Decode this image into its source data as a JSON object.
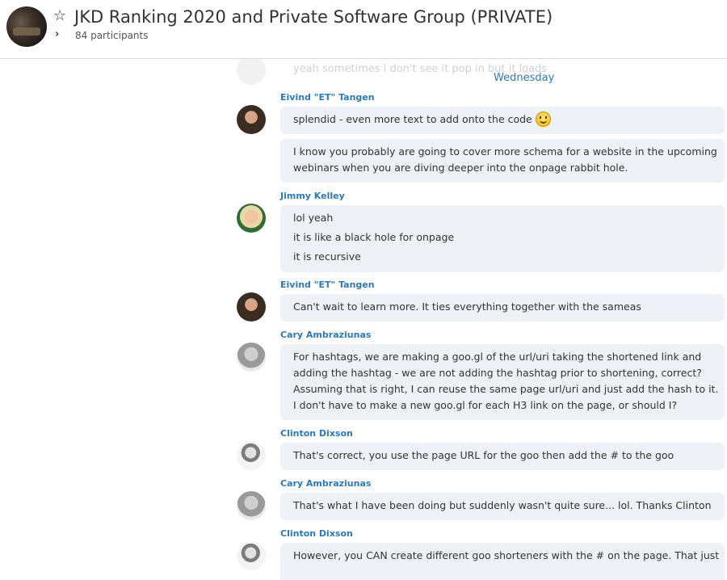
{
  "header": {
    "title": "JKD Ranking 2020 and Private Software Group (PRIVATE)",
    "participants": "84 participants",
    "star_icon": "star-icon",
    "chevron_icon": "chevron-right-icon"
  },
  "chat": {
    "ghost_text": "yeah sometimes i don't see it pop in but it loads",
    "date_divider": "Wednesday",
    "groups": [
      {
        "sender": "Eivind \"ET\" Tangen",
        "messages": [
          "splendid - even more text to add onto the code",
          [
            "I know you probably are going to cover more schema for a website in the upcoming",
            "webinars when you are diving deeper into the onpage rabbit hole."
          ]
        ]
      },
      {
        "sender": "Jimmy Kelley",
        "messages": [
          [
            "lol yeah",
            "it is like a black hole for onpage",
            "it is recursive"
          ]
        ]
      },
      {
        "sender": "Eivind \"ET\" Tangen",
        "messages": [
          "Can't wait to learn more. It ties everything together with the sameas"
        ]
      },
      {
        "sender": "Cary Ambraziunas",
        "messages": [
          [
            "For hashtags, we are making a goo.gl of the url/uri taking the shortened link and",
            "adding the hashtag - we are not adding the hashtag prior to shortening, correct?",
            "Assuming that is right, I can reuse the same page url/uri and just add the hash to it.",
            "I don't have to make a new goo.gl for each H3 link on the page, or should I?"
          ]
        ]
      },
      {
        "sender": "Clinton Dixson",
        "messages": [
          "That's correct, you use the page URL for the goo then add the # to the goo"
        ]
      },
      {
        "sender": "Cary Ambraziunas",
        "messages": [
          "That's what I have been doing but suddenly wasn't quite sure... lol.  Thanks Clinton"
        ]
      },
      {
        "sender": "Clinton Dixson",
        "messages": [
          "However, you CAN create different goo shorteners with the # on the page. That just"
        ]
      }
    ]
  },
  "colors": {
    "accent": "#2a7ab8",
    "bubble": "#eef1f5",
    "text": "#333333"
  }
}
